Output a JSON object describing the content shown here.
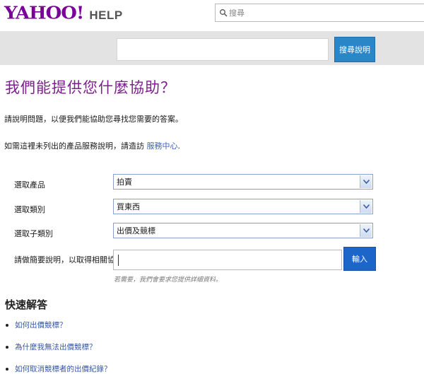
{
  "header": {
    "logo_text": "YAHOO!",
    "help_label": "HELP",
    "search_placeholder": "搜尋",
    "search_icon": "search-icon"
  },
  "search_band": {
    "input_value": "",
    "button_label": "搜尋說明"
  },
  "main": {
    "title": "我們能提供您什麼協助？",
    "intro": "請說明問題，以便我們能協助您尋找您需要的答案。",
    "intro2_prefix": "如需這裡未列出的產品服務說明，請造訪 ",
    "intro2_link": "服務中心",
    "intro2_suffix": "."
  },
  "form": {
    "product_label": "選取產品",
    "product_value": "拍賣",
    "category_label": "選取類別",
    "category_value": "買東西",
    "subcategory_label": "選取子類別",
    "subcategory_value": "出價及競標",
    "description_label": "請做簡要說明，以取得相關協助。",
    "description_value": "",
    "submit_label": "輸入",
    "hint": "若需要，我們會要求您提供詳細資料。"
  },
  "quick_answers": {
    "heading": "快速解答",
    "items": [
      {
        "label": "如何出價競標？"
      },
      {
        "label": "為什麼我無法出價競標？"
      },
      {
        "label": "如何取消競標者的出價紀錄？"
      }
    ]
  },
  "colors": {
    "brand": "#7b0099",
    "title": "#7d1f8e",
    "link": "#3356a8",
    "button_blue": "#2b86c7",
    "submit_blue": "#1d66c9",
    "band_gray": "#e3e3e3"
  }
}
